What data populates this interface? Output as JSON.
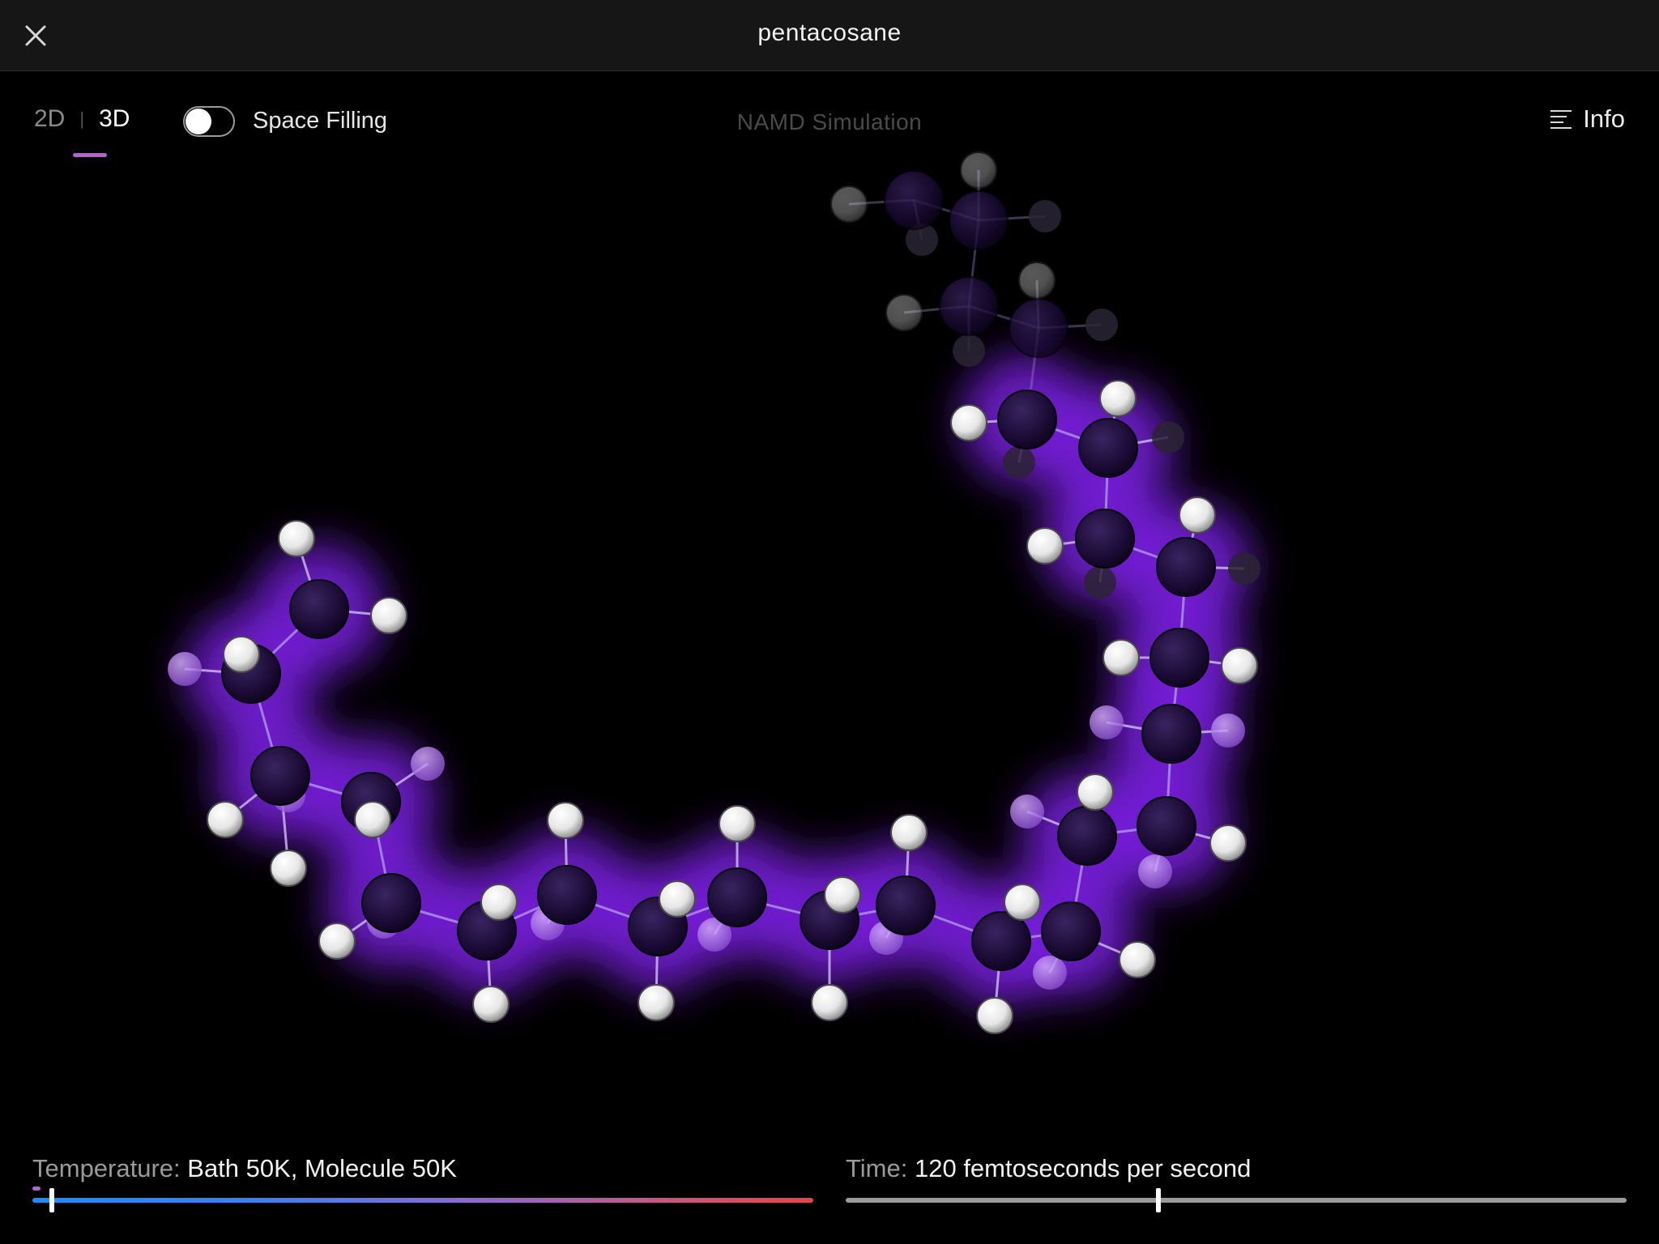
{
  "window": {
    "title": "pentacosane",
    "close_icon": "close-icon"
  },
  "toolbar": {
    "view_2d": "2D",
    "separator": "|",
    "view_3d": "3D",
    "selected_view": "3D",
    "space_filling_label": "Space Filling",
    "space_filling_on": false,
    "simulation_label": "NAMD Simulation",
    "info_label": "Info",
    "info_icon": "list-icon"
  },
  "molecule": {
    "name": "pentacosane",
    "render_mode": "ball-and-stick",
    "glow_color": "#7a1ee0",
    "carbon_color": "#1e0c3c",
    "hydrogen_color": "#f0f0f0"
  },
  "temperature": {
    "label": "Temperature:",
    "value": "Bath 50K, Molecule 50K",
    "slider_level_pct": 2.5,
    "gradient_start": "#1a8dff",
    "gradient_end": "#e84444"
  },
  "time": {
    "label": "Time:",
    "value": "120 femtoseconds per second",
    "slider_level_pct": 40
  },
  "colors": {
    "accent": "#b45fd8",
    "background": "#000000",
    "titlebar": "#161616"
  }
}
